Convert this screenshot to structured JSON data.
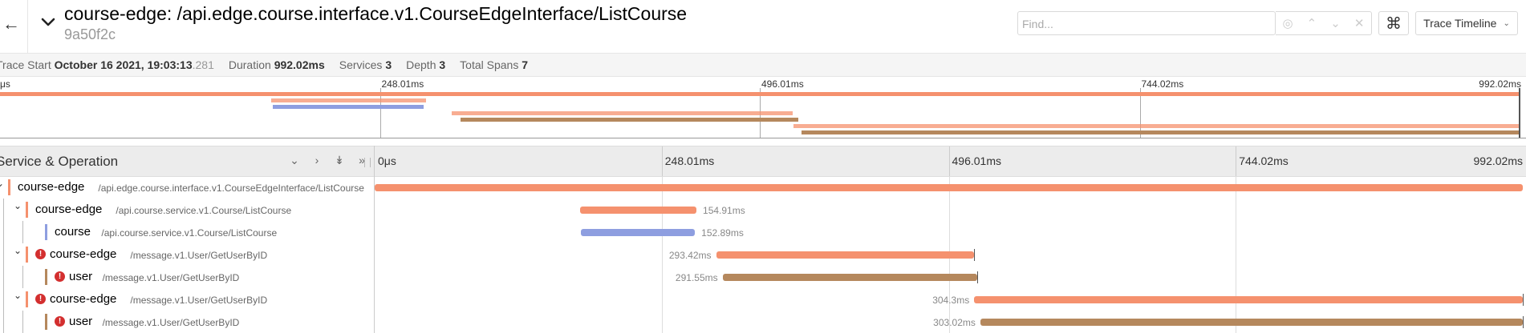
{
  "header": {
    "service": "course-edge",
    "operation": "/api.edge.course.interface.v1.CourseEdgeInterface/ListCourse",
    "title_sep": ": ",
    "trace_id": "9a50f2c",
    "find_placeholder": "Find...",
    "view_label": "Trace Timeline"
  },
  "summary": {
    "start_label": "Trace Start",
    "start_value": "October 16 2021, 19:03:13",
    "start_ms": ".281",
    "duration_label": "Duration",
    "duration_value": "992.02ms",
    "services_label": "Services",
    "services_value": "3",
    "depth_label": "Depth",
    "depth_value": "3",
    "spans_label": "Total Spans",
    "spans_value": "7"
  },
  "timeline": {
    "column_title": "Service & Operation",
    "ticks": [
      "0μs",
      "248.01ms",
      "496.01ms",
      "744.02ms",
      "992.02ms"
    ],
    "minimap_ticks": [
      "μs",
      "248.01ms",
      "496.01ms",
      "744.02ms",
      "992.02ms"
    ],
    "total_ms": 992.02
  },
  "colors": {
    "course-edge": "#f5916e",
    "course": "#8e9ee0",
    "user": "#b5885d"
  },
  "spans": [
    {
      "service": "course-edge",
      "operation": "/api.edge.course.interface.v1.CourseEdgeInterface/ListCourse",
      "depth": 0,
      "start": 0,
      "duration": 992.02,
      "duration_label": "",
      "error": false,
      "toggle": "expanded"
    },
    {
      "service": "course-edge",
      "operation": "/api.course.service.v1.Course/ListCourse",
      "depth": 1,
      "start": 177.2,
      "duration": 100.8,
      "duration_label": "154.91ms",
      "error": false,
      "toggle": "expanded"
    },
    {
      "service": "course",
      "operation": "/api.course.service.v1.Course/ListCourse",
      "depth": 2,
      "start": 177.9,
      "duration": 98.8,
      "duration_label": "152.89ms",
      "error": false,
      "toggle": "none"
    },
    {
      "service": "course-edge",
      "operation": "/message.v1.User/GetUserByID",
      "depth": 1,
      "start": 295.0,
      "duration": 222.7,
      "duration_label": "293.42ms",
      "error": true,
      "toggle": "expanded"
    },
    {
      "service": "user",
      "operation": "/message.v1.User/GetUserByID",
      "depth": 2,
      "start": 300.6,
      "duration": 220.3,
      "duration_label": "291.55ms",
      "error": true,
      "toggle": "none"
    },
    {
      "service": "course-edge",
      "operation": "/message.v1.User/GetUserByID",
      "depth": 1,
      "start": 518.0,
      "duration": 474.0,
      "duration_label": "304.3ms",
      "error": true,
      "toggle": "expanded"
    },
    {
      "service": "user",
      "operation": "/message.v1.User/GetUserByID",
      "depth": 2,
      "start": 523.3,
      "duration": 468.7,
      "duration_label": "303.02ms",
      "error": true,
      "toggle": "none"
    }
  ]
}
